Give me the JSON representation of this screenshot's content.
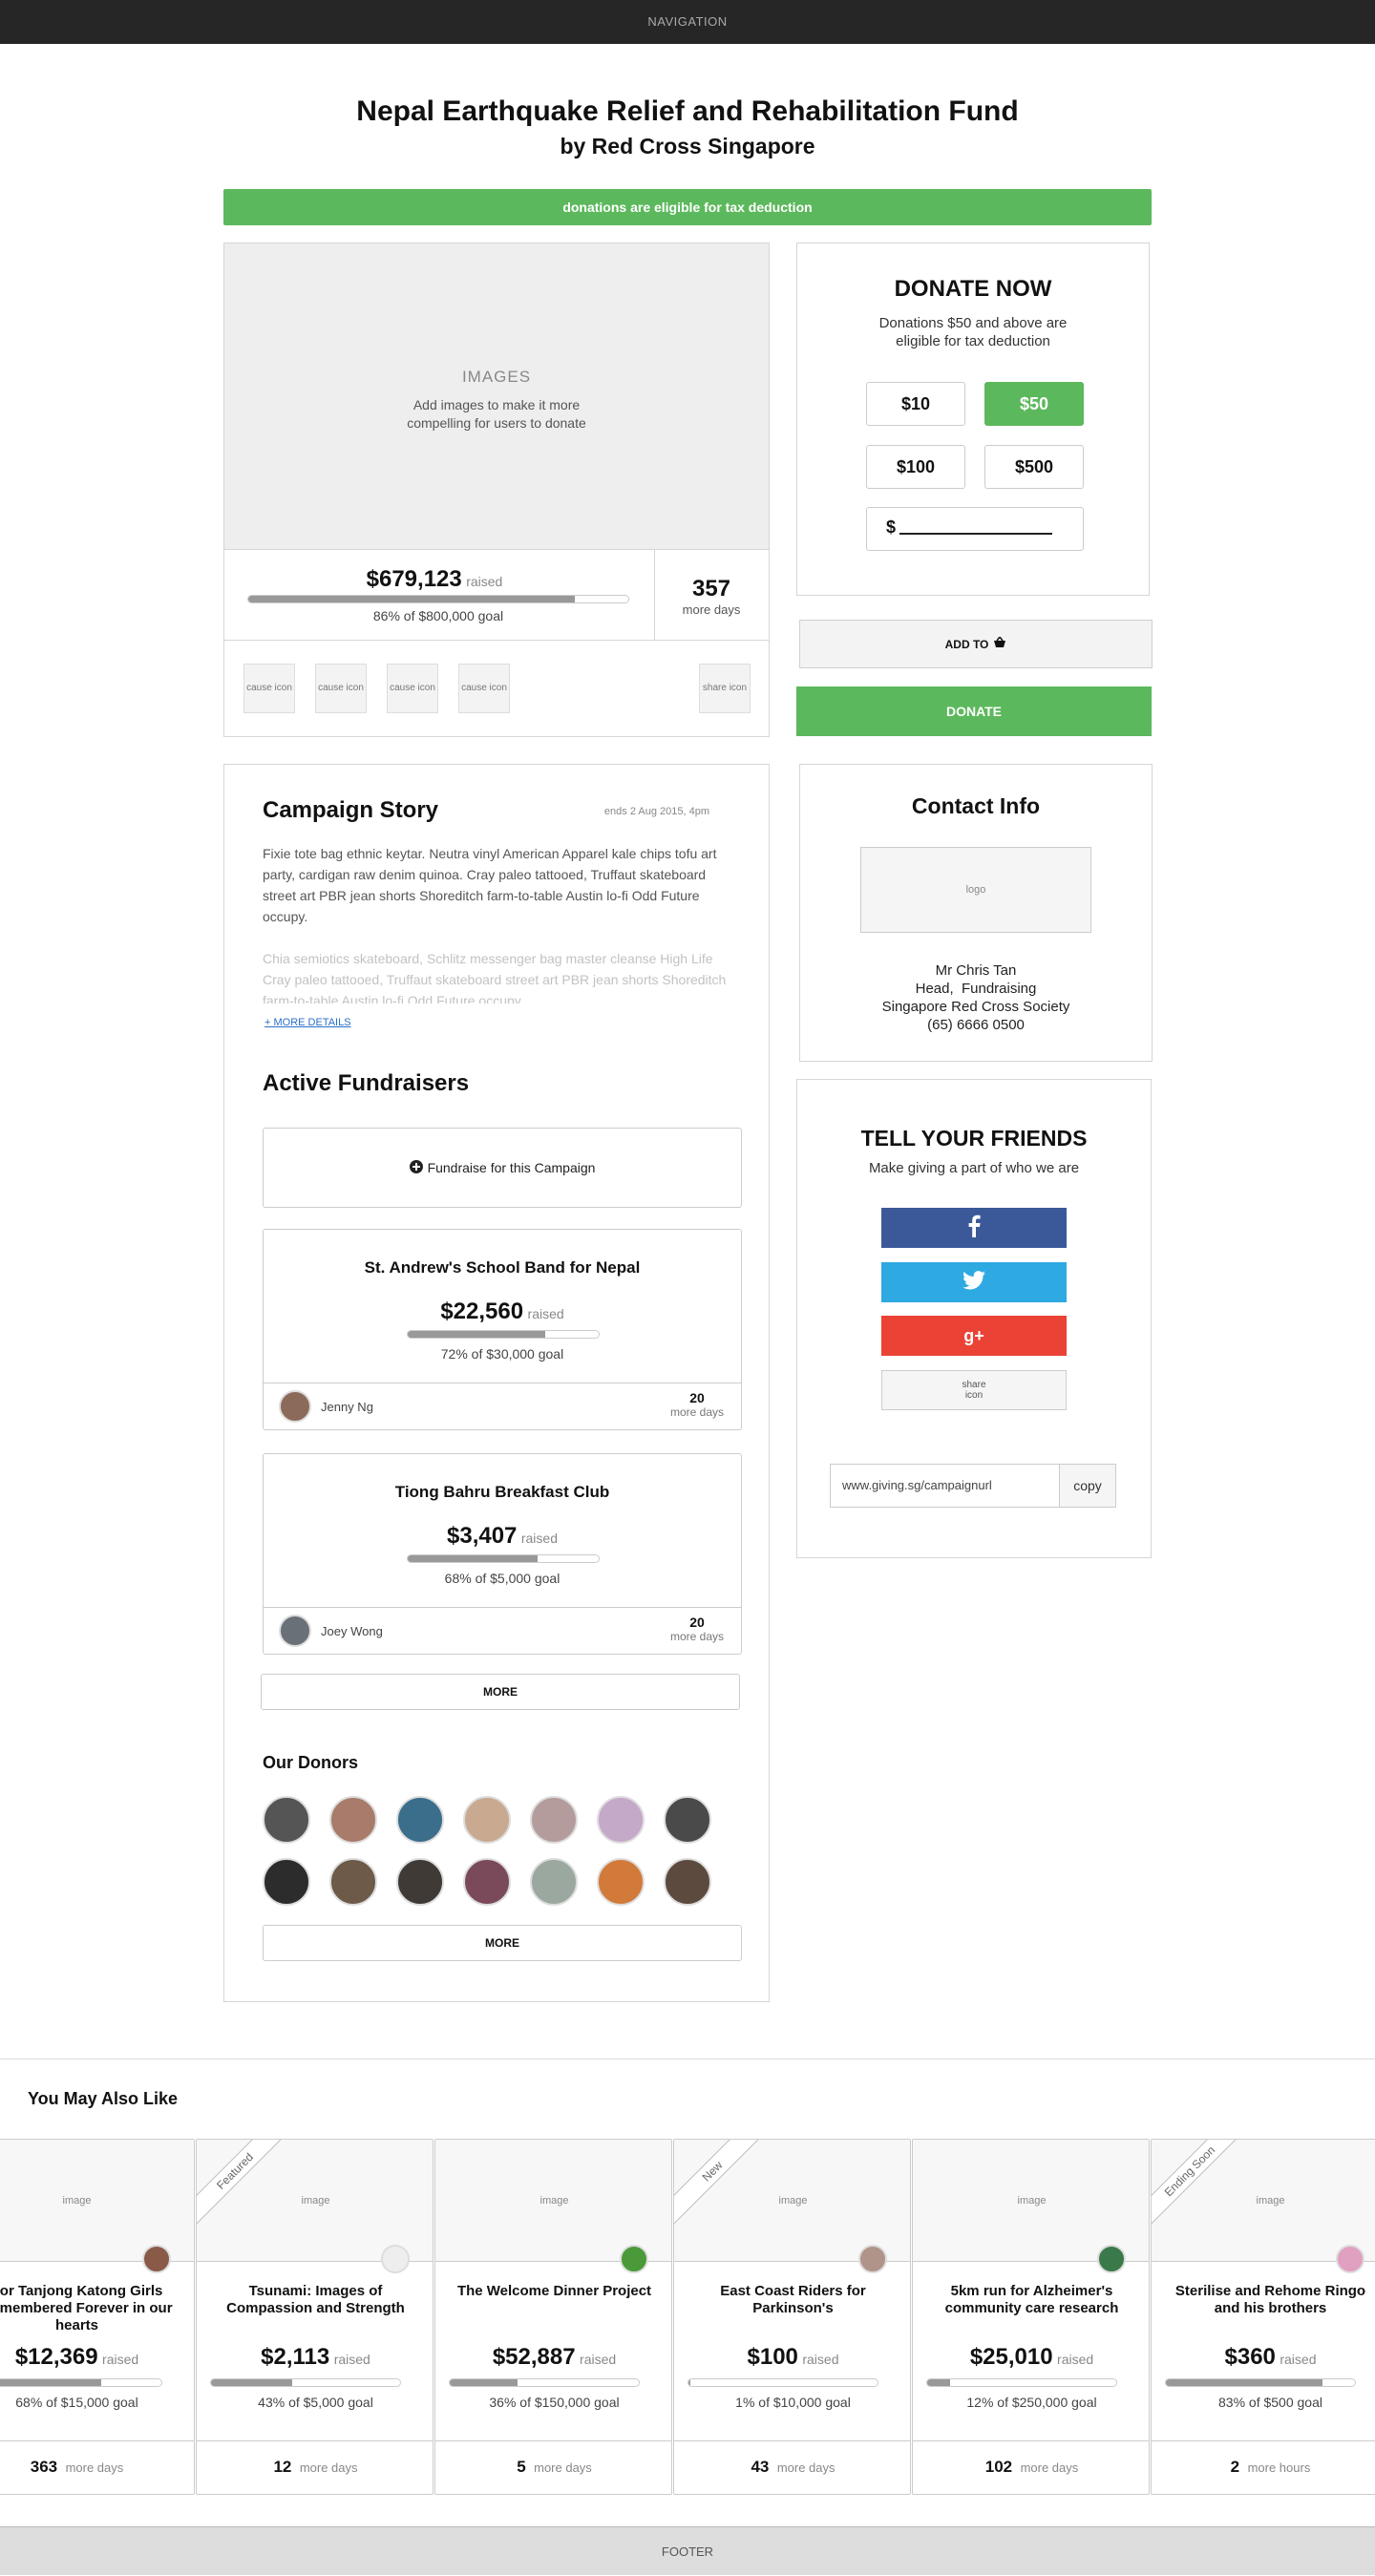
{
  "nav": {
    "label": "NAVIGATION"
  },
  "campaign": {
    "title": "Nepal Earthquake Relief and Rehabilitation Fund",
    "subtitle": "by Red Cross Singapore",
    "tax_banner": "donations are eligible for tax deduction",
    "images_label": "IMAGES",
    "images_hint": "Add images to make it more compelling for users to donate",
    "raised": "$679,123",
    "raised_label": "raised",
    "progress": 0.86,
    "goal_text": "86% of $800,000 goal",
    "days": "357",
    "days_label": "more days",
    "cause_icons": [
      "cause icon",
      "cause icon",
      "cause icon",
      "cause icon"
    ],
    "share_icon": "share icon"
  },
  "donate": {
    "title": "DONATE NOW",
    "note": "Donations $50 and above are eligible for tax deduction",
    "amounts": [
      "$10",
      "$50",
      "$100",
      "$500"
    ],
    "selected": "$50",
    "custom_prefix": "$",
    "add_to_label": "ADD TO",
    "donate_label": "DONATE"
  },
  "story": {
    "title": "Campaign Story",
    "ends": "ends 2 Aug 2015, 4pm",
    "para1": "Fixie tote bag ethnic keytar. Neutra vinyl American Apparel kale chips tofu art party, cardigan raw denim quinoa. Cray paleo tattooed, Truffaut skateboard street art PBR jean shorts Shoreditch farm-to-table Austin lo-fi Odd Future occupy.",
    "para2": "Chia semiotics skateboard, Schlitz messenger bag master cleanse High Life Cray paleo tattooed, Truffaut skateboard street art PBR jean shorts Shoreditch farm-to-table Austin lo-fi Odd Future occupy.",
    "more_details": "+ MORE DETAILS"
  },
  "fundraisers": {
    "title": "Active Fundraisers",
    "cta": "Fundraise for this Campaign",
    "items": [
      {
        "name": "St. Andrew's School Band for Nepal",
        "raised": "$22,560",
        "raised_label": "raised",
        "progress": 0.72,
        "goal": "72% of $30,000 goal",
        "owner": "Jenny Ng",
        "days": "20",
        "days_label": "more days"
      },
      {
        "name": "Tiong Bahru Breakfast Club",
        "raised": "$3,407",
        "raised_label": "raised",
        "progress": 0.68,
        "goal": "68% of $5,000 goal",
        "owner": "Joey Wong",
        "days": "20",
        "days_label": "more days"
      }
    ],
    "more_label": "MORE"
  },
  "donors": {
    "title": "Our Donors",
    "more_label": "MORE",
    "colors": [
      "#555",
      "#a87b6a",
      "#3a6e8a",
      "#c9a98f",
      "#b59c9c",
      "#c5a9c8",
      "#4a4a4a",
      "#2c2c2c",
      "#6d5a48",
      "#3f3a36",
      "#7a4a5a",
      "#9aa8a0",
      "#d27a3a",
      "#5c4a3e"
    ]
  },
  "contact": {
    "title": "Contact Info",
    "logo_label": "logo",
    "name": "Mr Chris Tan",
    "role": "Head,  Fundraising",
    "org": "Singapore Red Cross Society",
    "phone": "(65) 6666 0500"
  },
  "share": {
    "title": "TELL YOUR FRIENDS",
    "subtitle": "Make giving a part of who we are",
    "facebook_color": "#3b5998",
    "twitter_color": "#2ea9e1",
    "google_color": "#ea4335",
    "share_icon": "share icon",
    "url": "www.giving.sg/campaignurl",
    "copy_label": "copy"
  },
  "related": {
    "title": "You May Also Like",
    "image_label": "image",
    "items": [
      {
        "title": "For Tanjong Katong Girls Remembered Forever in our hearts",
        "raised": "$12,369",
        "raised_label": "raised",
        "progress": 0.68,
        "goal": "68% of $15,000 goal",
        "count": "363",
        "count_label": "more days",
        "ribbon": "",
        "avatar": "#8a5a48"
      },
      {
        "title": "Tsunami: Images of Compassion and Strength",
        "raised": "$2,113",
        "raised_label": "raised",
        "progress": 0.43,
        "goal": "43% of $5,000 goal",
        "count": "12",
        "count_label": "more days",
        "ribbon": "Featured",
        "avatar": "#eee"
      },
      {
        "title": "The Welcome Dinner Project",
        "raised": "$52,887",
        "raised_label": "raised",
        "progress": 0.36,
        "goal": "36% of $150,000 goal",
        "count": "5",
        "count_label": "more days",
        "ribbon": "",
        "avatar": "#4a9a3a"
      },
      {
        "title": "East Coast Riders for Parkinson's",
        "raised": "$100",
        "raised_label": "raised",
        "progress": 0.01,
        "goal": "1% of $10,000 goal",
        "count": "43",
        "count_label": "more days",
        "ribbon": "New",
        "avatar": "#b0948a"
      },
      {
        "title": "5km run for Alzheimer's community care research",
        "raised": "$25,010",
        "raised_label": "raised",
        "progress": 0.12,
        "goal": "12% of $250,000 goal",
        "count": "102",
        "count_label": "more days",
        "ribbon": "",
        "avatar": "#3a7a4a"
      },
      {
        "title": "Sterilise and Rehome Ringo and his brothers",
        "raised": "$360",
        "raised_label": "raised",
        "progress": 0.83,
        "goal": "83% of $500 goal",
        "count": "2",
        "count_label": "more hours",
        "ribbon": "Ending Soon",
        "avatar": "#e0a0c0"
      }
    ]
  },
  "footer": {
    "label": "FOOTER"
  }
}
